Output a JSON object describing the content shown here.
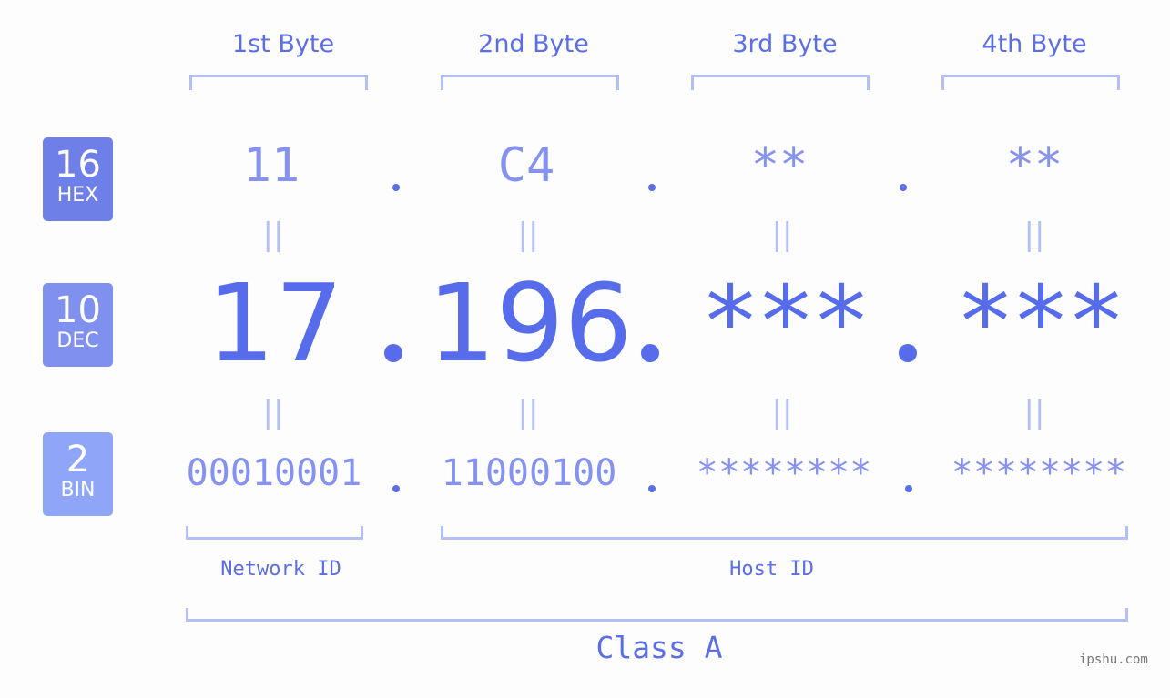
{
  "headers": [
    "1st Byte",
    "2nd Byte",
    "3rd Byte",
    "4th Byte"
  ],
  "badges": [
    {
      "base": "16",
      "label": "HEX",
      "color": "#6f7fe8"
    },
    {
      "base": "10",
      "label": "DEC",
      "color": "#8090ee"
    },
    {
      "base": "2",
      "label": "BIN",
      "color": "#8fa5f7"
    }
  ],
  "hex": [
    "11",
    "C4",
    "**",
    "**"
  ],
  "dec": [
    "17",
    "196",
    "***",
    "***"
  ],
  "bin": [
    "00010001",
    "11000100",
    "********",
    "********"
  ],
  "equals_glyph": "||",
  "network_id_label": "Network ID",
  "host_id_label": "Host ID",
  "class_label": "Class A",
  "watermark": "ipshu.com",
  "colors": {
    "accent": "#566ceb",
    "bracket": "#b4bef7",
    "muted": "#8592ef"
  }
}
